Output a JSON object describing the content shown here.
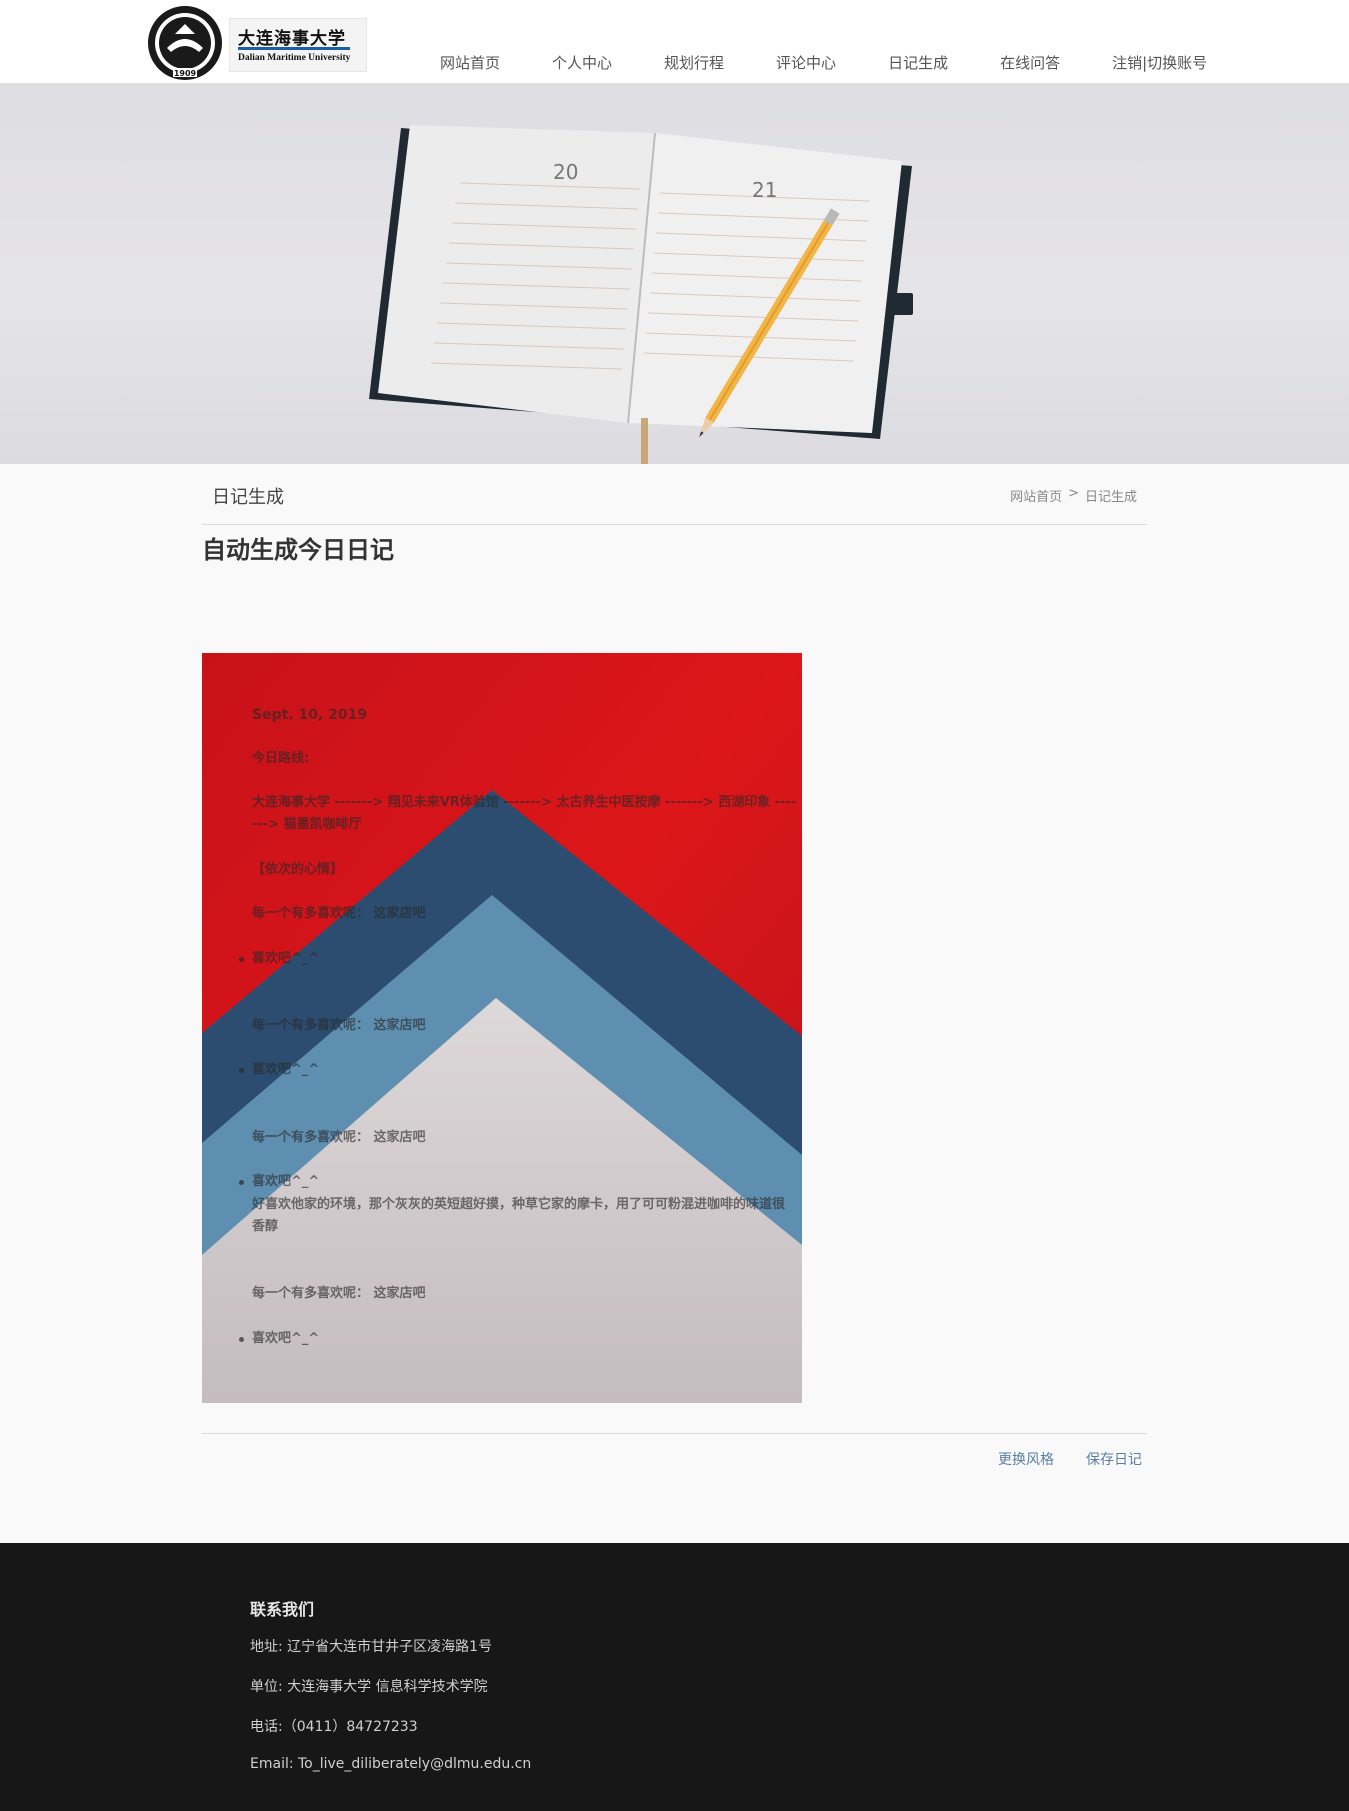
{
  "header": {
    "logo_cn": "大连海事大学",
    "logo_en": "Dalian Maritime University",
    "nav": [
      "网站首页",
      "个人中心",
      "规划行程",
      "评论中心",
      "日记生成",
      "在线问答",
      "注销|切换账号"
    ]
  },
  "page": {
    "section_title": "日记生成",
    "breadcrumb": {
      "home": "网站首页",
      "sep": ">",
      "current": "日记生成"
    },
    "heading": "自动生成今日日记"
  },
  "diary": {
    "date": "Sept. 10, 2019",
    "route_label": "今日路线:",
    "route": "大连海事大学 -------> 翔见未来VR体验馆 -------> 太古养生中医按摩 -------> 西湖印象 -------> 猫墨凯咖啡厅",
    "mood_header": "【依次的心情】",
    "entries": [
      {
        "question": "每一个有多喜欢呢： 这家店吧",
        "answer": "喜欢吧^_^",
        "comment": ""
      },
      {
        "question": "每一个有多喜欢呢： 这家店吧",
        "answer": "喜欢吧^_^",
        "comment": ""
      },
      {
        "question": "每一个有多喜欢呢： 这家店吧",
        "answer": "喜欢吧^_^",
        "comment": "好喜欢他家的环境，那个灰灰的英短超好摸，种草它家的摩卡，用了可可粉混进咖啡的味道很香醇"
      },
      {
        "question": "每一个有多喜欢呢： 这家店吧",
        "answer": "喜欢吧^_^",
        "comment": ""
      }
    ]
  },
  "actions": {
    "change_style": "更换风格",
    "save": "保存日记"
  },
  "footer": {
    "title": "联系我们",
    "address": "地址: 辽宁省大连市甘井子区凌海路1号",
    "unit": "单位: 大连海事大学 信息科学技术学院",
    "phone": "电话:（0411）84727233",
    "email": "Email: To_live_diliberately@dlmu.edu.cn"
  },
  "colors": {
    "nav_text": "#555555",
    "action_link": "#5a7fa5",
    "footer_bg": "#171717",
    "diary_red": "#d4171a",
    "diary_navy": "#2c4d70",
    "diary_blue": "#5f8fb0"
  }
}
